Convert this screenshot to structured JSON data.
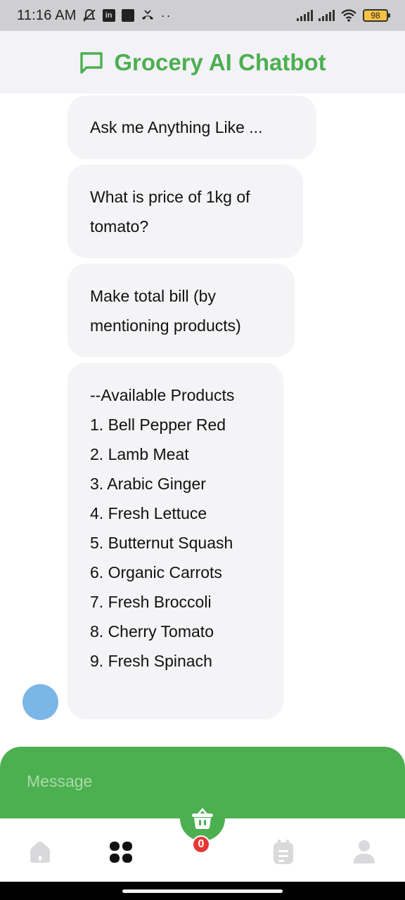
{
  "status_bar": {
    "time": "11:16 AM",
    "battery": "98"
  },
  "app_bar": {
    "title": "Grocery AI Chatbot",
    "icon": "chat-bubble-icon",
    "accent": "#4caf50"
  },
  "messages": [
    {
      "lines": [
        "Ask me Anything Like ..."
      ]
    },
    {
      "lines": [
        "What is price of 1kg of",
        "tomato?"
      ]
    },
    {
      "lines": [
        "Make total bill (by",
        "mentioning products)"
      ]
    },
    {
      "lines": [
        "--Available Products",
        "1. Bell Pepper Red",
        "2. Lamb Meat",
        "3. Arabic Ginger",
        "4. Fresh Lettuce",
        "5. Butternut Squash",
        "6. Organic Carrots",
        "7. Fresh Broccoli",
        "8. Cherry Tomato",
        "9. Fresh Spinach"
      ]
    }
  ],
  "input": {
    "placeholder": "Message"
  },
  "cart": {
    "count": "0",
    "icon": "shopping-basket-icon"
  },
  "nav": {
    "items": [
      {
        "name": "home",
        "icon": "home-icon"
      },
      {
        "name": "categories",
        "icon": "grid-icon"
      },
      {
        "name": "orders",
        "icon": "clipboard-icon"
      },
      {
        "name": "profile",
        "icon": "person-icon"
      }
    ]
  }
}
